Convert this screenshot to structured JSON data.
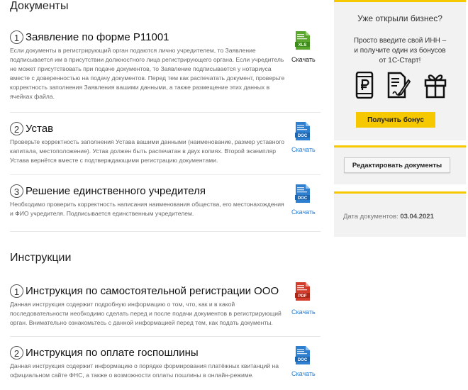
{
  "documents_section": {
    "title": "Документы",
    "items": [
      {
        "number": "1",
        "title": "Заявление по форме Р11001",
        "description": "Если документы в регистрирующий орган подаются лично учредителем, то Заявление подписывается им в присутствии должностного лица регистрирующего органа. Если учредитель не может присутствовать при подаче документов, то Заявление подписывается у нотариуса вместе с доверенностью на подачу документов. Перед тем как распечатать документ, проверьте корректность заполнения Заявления вашими данными, а также размещение этих данных в ячейках файла.",
        "file_type": "XLS",
        "download_label": "Скачать"
      },
      {
        "number": "2",
        "title": "Устав",
        "description": "Проверьте корректность заполнения Устава вашими данными (наименование, размер уставного капитала, местоположение). Устав должен быть распечатан в двух копиях. Второй экземпляр Устава вернётся вместе с подтверждающими регистрацию документами.",
        "file_type": "DOC",
        "download_label": "Скачать"
      },
      {
        "number": "3",
        "title": "Решение единственного учредителя",
        "description": "Необходимо проверить корректность написания наименования общества, его местонахождения и ФИО учредителя. Подписывается единственным учредителем.",
        "file_type": "DOC",
        "download_label": "Скачать"
      }
    ]
  },
  "instructions_section": {
    "title": "Инструкции",
    "items": [
      {
        "number": "1",
        "title": "Инструкция по самостоятельной регистрации ООО",
        "description": "Данная инструкция содержит подробную информацию о том, что, как и в какой последовательности необходимо сделать перед и после подачи документов в регистрирующий орган. Внимательно ознакомьтесь с данной информацией перед тем, как подать документы.",
        "file_type": "PDF",
        "download_label": "Скачать"
      },
      {
        "number": "2",
        "title": "Инструкция по оплате госпошлины",
        "description": "Данная инструкция содержит информацию о порядке формирования платёжных квитанций на официальном сайте ФНС, а также о возможности оплаты пошлины в онлайн-режиме.",
        "file_type": "DOC",
        "download_label": "Скачать"
      }
    ]
  },
  "sidebar": {
    "promo": {
      "title": "Уже открыли бизнес?",
      "line1": "Просто введите свой ИНН –",
      "line2": "и получите один из бонусов",
      "line3": "от 1С-Старт!",
      "button_label": "Получить бонус",
      "icons": [
        "phone-ruble-icon",
        "document-pen-icon",
        "gift-icon"
      ]
    },
    "edit_button_label": "Редактировать документы",
    "date_label": "Дата документов:",
    "date_value": "03.04.2021"
  },
  "colors": {
    "accent": "#f5c800",
    "link": "#2a7cd1",
    "xls": "#5aa52c",
    "doc": "#2f7fd0",
    "pdf": "#d23b2a"
  }
}
